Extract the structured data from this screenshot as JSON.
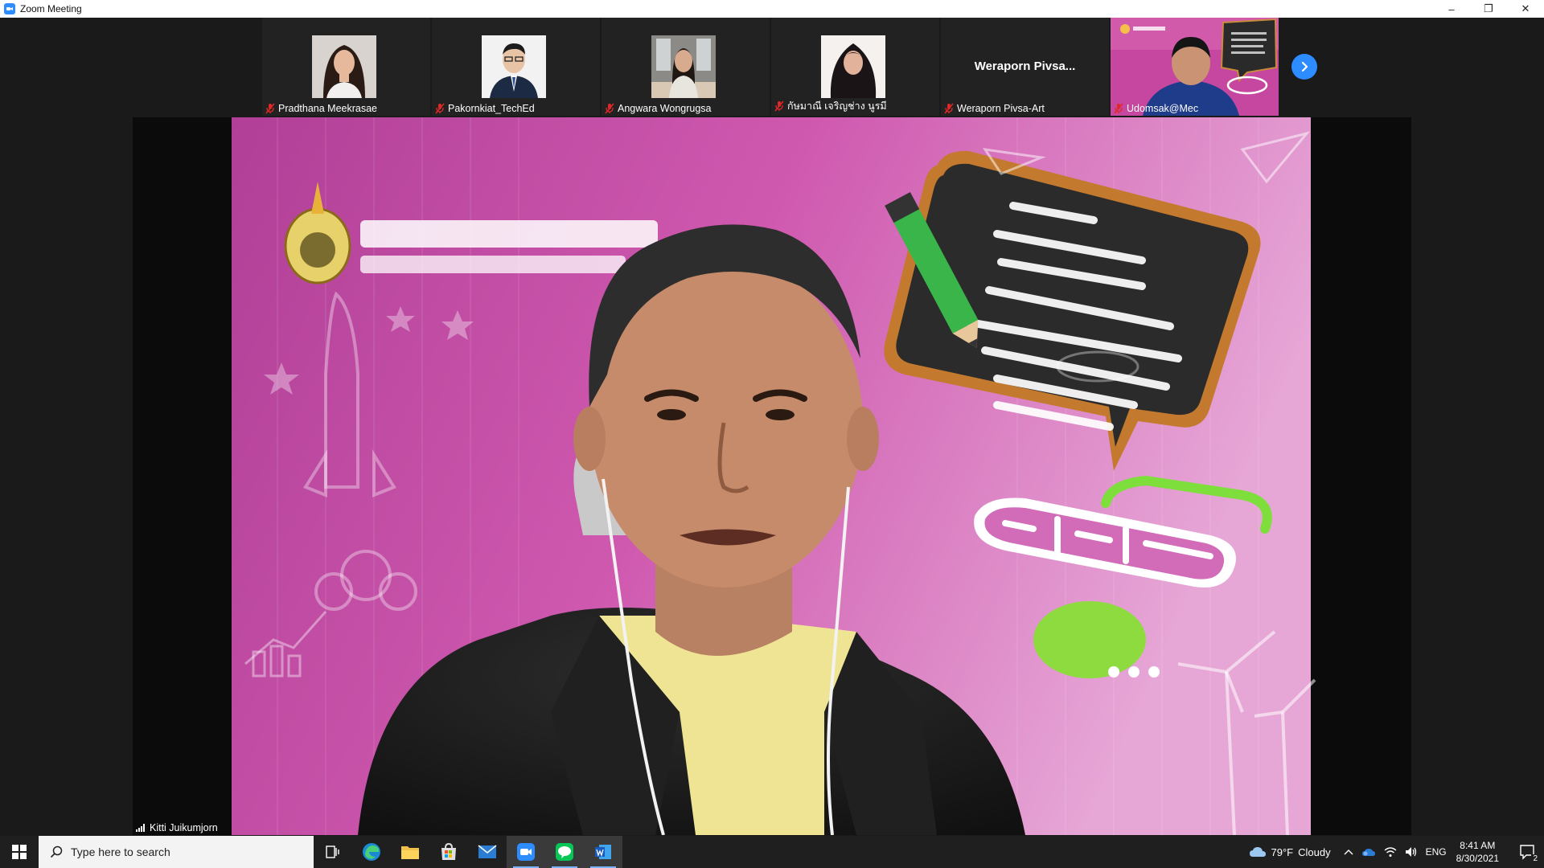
{
  "window": {
    "title": "Zoom Meeting",
    "controls": [
      "–",
      "❐",
      "✕"
    ]
  },
  "participants": [
    {
      "name": "Pradthana Meekrasae",
      "muted": true,
      "has_video": false
    },
    {
      "name": "Pakornkiat_TechEd",
      "muted": true,
      "has_video": false
    },
    {
      "name": "Angwara Wongrugsa",
      "muted": true,
      "has_video": false
    },
    {
      "name": "กัษมาณี เจริญช่าง นูรมี",
      "muted": true,
      "has_video": false
    },
    {
      "name": "Weraporn Pivsa-Art",
      "display_label": "Weraporn  Pivsa...",
      "muted": true,
      "has_video": false
    },
    {
      "name": "Udomsak@Mec",
      "muted": true,
      "has_video": true
    }
  ],
  "next_page_icon": "chevron-right-icon",
  "speaker": {
    "name": "Kitti Juikumjorn",
    "signal_icon": "signal-bars-icon"
  },
  "taskbar": {
    "search_placeholder": "Type here to search",
    "apps": [
      "task-view-icon",
      "edge-icon",
      "file-explorer-icon",
      "store-icon",
      "mail-icon",
      "zoom-icon",
      "line-icon",
      "word-icon"
    ],
    "weather_temp": "79°F",
    "weather_desc": "Cloudy",
    "language": "ENG",
    "time": "8:41 AM",
    "date": "8/30/2021",
    "notification_count": "2"
  },
  "colors": {
    "zoom_blue": "#2d8cff",
    "mute_red": "#e02828",
    "banner_pink": "#c0489f"
  }
}
